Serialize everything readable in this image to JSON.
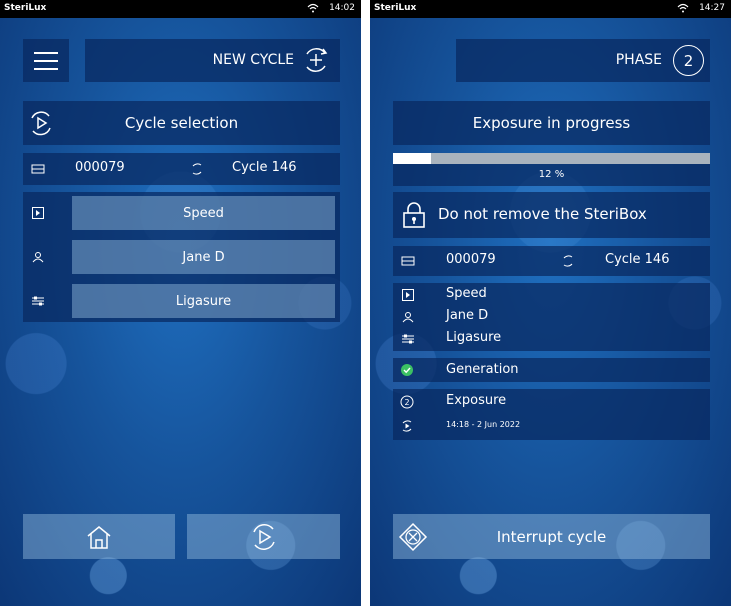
{
  "left": {
    "status": {
      "brand": "SteriLux",
      "time": "14:02"
    },
    "header": {
      "title": "NEW CYCLE"
    },
    "cycle_selection": {
      "title": "Cycle selection"
    },
    "info": {
      "device_id": "000079",
      "cycle": "Cycle 146"
    },
    "options": [
      {
        "icon": "program-icon",
        "label": "Speed"
      },
      {
        "icon": "user-icon",
        "label": "Jane D"
      },
      {
        "icon": "instrument-icon",
        "label": "Ligasure"
      }
    ],
    "footer": {
      "home_icon": "home-icon",
      "start_icon": "start-cycle-icon"
    }
  },
  "right": {
    "status": {
      "brand": "SteriLux",
      "time": "14:27"
    },
    "header": {
      "title": "PHASE",
      "phase_number": "2"
    },
    "progress": {
      "title": "Exposure in progress",
      "percent_label": "12 %",
      "fraction": 0.12
    },
    "warning": {
      "text": "Do not remove the SteriBox"
    },
    "info": {
      "device_id": "000079",
      "cycle": "Cycle 146"
    },
    "details": {
      "program": "Speed",
      "user": "Jane D",
      "instrument": "Ligasure"
    },
    "generation": {
      "label": "Generation"
    },
    "exposure": {
      "label": "Exposure",
      "start": "14:18 - 2 Jun 2022"
    },
    "interrupt": {
      "label": "Interrupt cycle"
    }
  },
  "colors": {
    "accent_green": "#3cc063",
    "progress_fill": "#ffffff",
    "progress_track": "#a9b3bd"
  }
}
